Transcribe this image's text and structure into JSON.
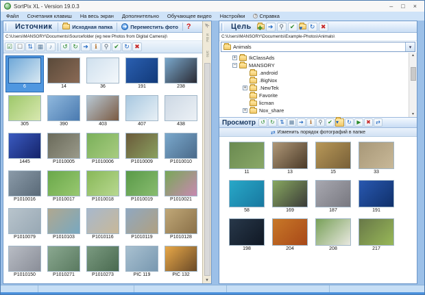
{
  "window": {
    "title": "SortPix XL - Version 19.0.3",
    "controls": {
      "minimize": "–",
      "maximize": "□",
      "close": "×"
    }
  },
  "colors": {
    "frame_blue": "#9cc0e8",
    "header_text": "#16355e",
    "selection_blue": "#4f97e0",
    "delete_red": "#c62828"
  },
  "menu": {
    "items": [
      {
        "name": "menu-file",
        "label": "Файл",
        "icon": ""
      },
      {
        "name": "menu-shortcuts",
        "label": "Сочетания клавиш",
        "icon": ""
      },
      {
        "name": "menu-fullscreen",
        "label": "На весь экран",
        "icon": ""
      },
      {
        "name": "menu-extras",
        "label": "Дополнительно",
        "icon": ""
      },
      {
        "name": "menu-tutorial-video",
        "label": "Обучающее видео",
        "icon": ""
      },
      {
        "name": "menu-settings",
        "label": "Настройки",
        "icon": ""
      },
      {
        "name": "menu-help",
        "label": "Справка",
        "icon": "?"
      }
    ]
  },
  "source_panel": {
    "title": "Источник",
    "source_folder_button": "Исходная папка",
    "move_photo_button": "Переместить фото",
    "move_photo_glyph": "➔",
    "help_glyph": "?",
    "path": "C:\\Users\\MANSORY\\Documents\\Sourcefolder (eg new Photos from Digital Camera)\\",
    "toolbar": [
      {
        "name": "select-all-icon",
        "glyph": "☑",
        "color": "#2a7d2a"
      },
      {
        "name": "deselect-all-icon",
        "glyph": "☐",
        "color": "#666666"
      },
      {
        "name": "sort-icon",
        "glyph": "⇅",
        "color": "#1560c0"
      },
      {
        "name": "slideshow-icon",
        "glyph": "▦",
        "color": "#6080a0"
      },
      {
        "name": "audio-icon",
        "glyph": "♪",
        "color": "#6080a0"
      },
      {
        "name": "toolbar-divider",
        "glyph": "",
        "cls": "sep"
      },
      {
        "name": "rotate-left-icon",
        "glyph": "↺",
        "color": "#2a8a2a"
      },
      {
        "name": "rotate-right-icon",
        "glyph": "↻",
        "color": "#2a8a2a"
      },
      {
        "name": "move-right-icon",
        "glyph": "➔",
        "color": "#1560c0"
      },
      {
        "name": "image-info-icon",
        "glyph": "ℹ",
        "color": "#b06820"
      },
      {
        "name": "magnifier-icon",
        "glyph": "⚲",
        "color": "#506070"
      },
      {
        "name": "edit-check-icon",
        "glyph": "✔",
        "color": "#2a8a2a"
      },
      {
        "name": "refresh-icon",
        "glyph": "↻",
        "color": "#1560c0"
      },
      {
        "name": "delete-icon",
        "glyph": "✖",
        "color": "#c62828"
      }
    ],
    "strip": {
      "collapse_glyph": "≪",
      "fragments": [
        "и вы",
        "эле"
      ],
      "down_glyph": "▾"
    },
    "thumbnails": [
      {
        "label": "6",
        "g": [
          "#6fa8d8",
          "#d8e8f2"
        ],
        "cls": "sel"
      },
      {
        "label": "14",
        "g": [
          "#5a4a3a",
          "#8a6a55"
        ]
      },
      {
        "label": "36",
        "g": [
          "#cfe0ee",
          "#f4f8fb"
        ]
      },
      {
        "label": "191",
        "g": [
          "#2a5fb0",
          "#123a7a"
        ]
      },
      {
        "label": "238",
        "g": [
          "#7aa8cc",
          "#2a2a33"
        ]
      },
      {
        "label": "305",
        "g": [
          "#9ec86a",
          "#d8e8b0"
        ]
      },
      {
        "label": "390",
        "g": [
          "#8fb8dd",
          "#4a7ab0"
        ]
      },
      {
        "label": "403",
        "g": [
          "#b8c8d4",
          "#7a5a42"
        ]
      },
      {
        "label": "407",
        "g": [
          "#a8c8e0",
          "#e8f0f6"
        ]
      },
      {
        "label": "438",
        "g": [
          "#cdd8e4",
          "#ecf1f6"
        ]
      },
      {
        "label": "1445",
        "g": [
          "#3a5ac0",
          "#15246a"
        ]
      },
      {
        "label": "P1010005",
        "g": [
          "#6a6a5a",
          "#9a9a8a"
        ]
      },
      {
        "label": "P1010006",
        "g": [
          "#7ab05a",
          "#a8cc80"
        ]
      },
      {
        "label": "P1010009",
        "g": [
          "#6a5a3a",
          "#8aa060"
        ]
      },
      {
        "label": "P1010010",
        "g": [
          "#7aa8cc",
          "#4a6a8a"
        ]
      },
      {
        "label": "P1010016",
        "g": [
          "#8a9aa8",
          "#5a6a78"
        ]
      },
      {
        "label": "P1010017",
        "g": [
          "#6aa84a",
          "#98c870"
        ]
      },
      {
        "label": "P1010018",
        "g": [
          "#88b858",
          "#b8d890"
        ]
      },
      {
        "label": "P1010019",
        "g": [
          "#5a9a48",
          "#88bc70"
        ]
      },
      {
        "label": "P1010021",
        "g": [
          "#78a858",
          "#c888b0"
        ]
      },
      {
        "label": "P1010079",
        "g": [
          "#b8c4cc",
          "#98a8b4"
        ]
      },
      {
        "label": "P1010103",
        "g": [
          "#b0a890",
          "#78a8c0"
        ]
      },
      {
        "label": "P1010116",
        "g": [
          "#a8b8cc",
          "#c8b898"
        ]
      },
      {
        "label": "P1010119",
        "g": [
          "#90a8c0",
          "#b0a080"
        ]
      },
      {
        "label": "P1010128",
        "g": [
          "#c0a878",
          "#8a7048"
        ]
      },
      {
        "label": "P1010150",
        "g": [
          "#b8bcc4",
          "#8a8e98"
        ]
      },
      {
        "label": "P1010271",
        "g": [
          "#8aa890",
          "#5a7a60"
        ]
      },
      {
        "label": "P1010273",
        "g": [
          "#7a9a80",
          "#4a6a50"
        ]
      },
      {
        "label": "PIC 119",
        "g": [
          "#a8c0d0",
          "#7898b0"
        ]
      },
      {
        "label": "PIC 132",
        "g": [
          "#e8a848",
          "#6a4a28"
        ]
      }
    ]
  },
  "target_panel": {
    "title": "Цель",
    "path": "C:\\Users\\MANSORY\\Documents\\Example-Photos\\Animals\\",
    "folder_combo": "Animals",
    "combo_arrow": "▾",
    "toolbar": [
      {
        "name": "new-folder-icon",
        "glyph": "✚",
        "color": "#2a8a2a",
        "cls": "fold"
      },
      {
        "name": "move-right-icon",
        "glyph": "➔",
        "color": "#1560c0"
      },
      {
        "name": "magnifier-icon",
        "glyph": "⚲",
        "color": "#506070"
      },
      {
        "name": "edit-check-icon",
        "glyph": "✔",
        "color": "#2a8a2a"
      },
      {
        "name": "target-folder-icon",
        "glyph": "▾",
        "color": "#1560c0",
        "cls": "fold"
      },
      {
        "name": "refresh-icon",
        "glyph": "↻",
        "color": "#1560c0"
      },
      {
        "name": "delete-icon",
        "glyph": "✖",
        "color": "#c62828"
      }
    ],
    "tree": [
      {
        "label": "IkClassAds",
        "glyph": "+",
        "cls": "lvl1"
      },
      {
        "label": "MANSORY",
        "glyph": "−",
        "cls": "lvl1"
      },
      {
        "label": ".android",
        "glyph": "",
        "cls": "lvl2"
      },
      {
        "label": ".BigNox",
        "glyph": "",
        "cls": "lvl2"
      },
      {
        "label": ".NewTek",
        "glyph": "+",
        "cls": "lvl2"
      },
      {
        "label": "Favorite",
        "glyph": "",
        "cls": "lvl2"
      },
      {
        "label": "licman",
        "glyph": "",
        "cls": "lvl2"
      },
      {
        "label": "Nox_share",
        "glyph": "+",
        "cls": "lvl2"
      }
    ],
    "tree_scroll": {
      "up": "▴",
      "down": "▾"
    },
    "preview": {
      "title": "Просмотр",
      "toolbar": [
        {
          "name": "rotate-left-icon",
          "glyph": "↺",
          "color": "#2a8a2a"
        },
        {
          "name": "rotate-right-icon",
          "glyph": "↻",
          "color": "#2a8a2a"
        },
        {
          "name": "sort-icon",
          "glyph": "⇅",
          "color": "#1560c0"
        },
        {
          "name": "slideshow-icon",
          "glyph": "▦",
          "color": "#6080a0"
        },
        {
          "name": "move-right-icon",
          "glyph": "➔",
          "color": "#1560c0"
        },
        {
          "name": "image-info-icon",
          "glyph": "ℹ",
          "color": "#b06820"
        },
        {
          "name": "magnifier-icon",
          "glyph": "⚲",
          "color": "#506070"
        },
        {
          "name": "edit-check-icon",
          "glyph": "✔",
          "color": "#2a8a2a"
        },
        {
          "name": "target-folder-icon",
          "glyph": "▾",
          "color": "#1560c0",
          "cls": "fold"
        },
        {
          "name": "refresh-icon",
          "glyph": "↻",
          "color": "#1560c0"
        },
        {
          "name": "play-icon",
          "glyph": "▶",
          "color": "#2a8a2a"
        },
        {
          "name": "delete-icon",
          "glyph": "✖",
          "color": "#c62828"
        },
        {
          "name": "reorder-icon",
          "glyph": "⇄",
          "color": "#1560c0"
        }
      ],
      "reorder_icon": "⇄",
      "reorder_label": "Изменить порядок фотографий в папке"
    },
    "thumbnails": [
      {
        "label": "11",
        "g": [
          "#6a8a50",
          "#8aa868"
        ]
      },
      {
        "label": "13",
        "g": [
          "#b09878",
          "#4a3a28"
        ]
      },
      {
        "label": "15",
        "g": [
          "#b89858",
          "#786038"
        ]
      },
      {
        "label": "33",
        "g": [
          "#a89878",
          "#c8b898"
        ]
      },
      {
        "label": "58",
        "g": [
          "#28a8c8",
          "#1878a0"
        ]
      },
      {
        "label": "169",
        "g": [
          "#88a860",
          "#3a3a38"
        ]
      },
      {
        "label": "187",
        "g": [
          "#a8a8b0",
          "#787880"
        ]
      },
      {
        "label": "191",
        "g": [
          "#2858b0",
          "#10306a"
        ]
      },
      {
        "label": "198",
        "g": [
          "#28384a",
          "#101824"
        ]
      },
      {
        "label": "204",
        "g": [
          "#c87828",
          "#a84818"
        ]
      },
      {
        "label": "208",
        "g": [
          "#78a058",
          "#e8e8e0"
        ]
      },
      {
        "label": "217",
        "g": [
          "#687848",
          "#98b858"
        ]
      }
    ]
  }
}
